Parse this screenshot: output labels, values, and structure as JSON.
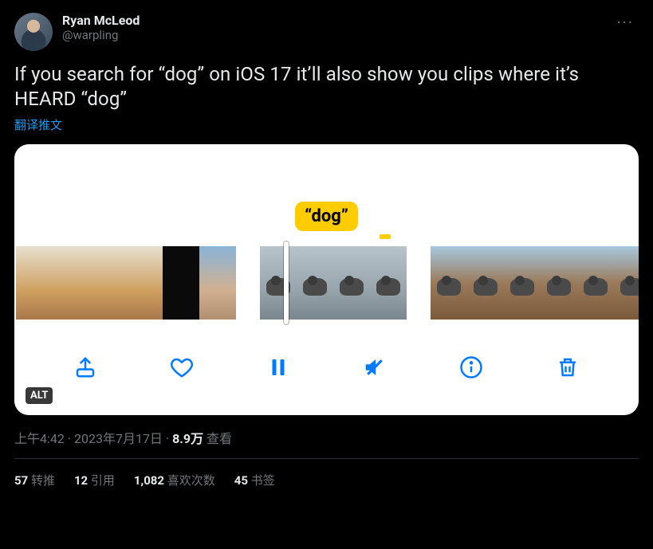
{
  "author": {
    "display_name": "Ryan McLeod",
    "handle": "@warpling"
  },
  "body": "If you search for “dog” on iOS 17 it’ll also show you clips where it’s HEARD “dog”",
  "translate_label": "翻译推文",
  "media": {
    "caption_bubble": "“dog”",
    "alt_badge": "ALT",
    "toolbar": {
      "share": "share",
      "like": "like",
      "pause": "pause",
      "mute": "mute",
      "info": "info",
      "delete": "delete"
    }
  },
  "meta": {
    "time": "上午4:42",
    "dot1": " · ",
    "date": "2023年7月17日",
    "dot2": " · ",
    "views_value": "8.9万",
    "views_label": " 查看"
  },
  "stats": {
    "retweets": {
      "value": "57",
      "label": " 转推"
    },
    "quotes": {
      "value": "12",
      "label": " 引用"
    },
    "likes": {
      "value": "1,082",
      "label": " 喜欢次数"
    },
    "bookmarks": {
      "value": "45",
      "label": " 书签"
    }
  }
}
